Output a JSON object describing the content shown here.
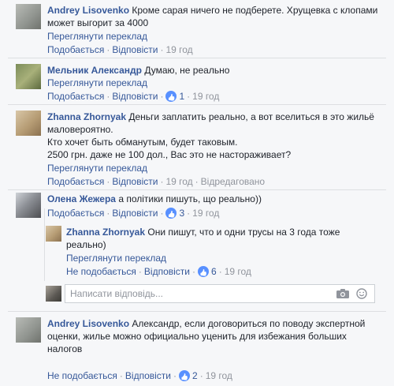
{
  "comments": [
    {
      "author": "Andrey Lisovenko",
      "text_lines": [
        "Кроме сарая ничего не подберете. Хрущевка с клопами",
        "может выгорит за 4000"
      ],
      "see_translation": "Переглянути переклад",
      "like_label": "Подобається",
      "reply_label": "Відповісти",
      "time": "19 год"
    },
    {
      "author": "Мельник Александр",
      "text_lines": [
        "Думаю, не реально"
      ],
      "see_translation": "Переглянути переклад",
      "like_label": "Подобається",
      "reply_label": "Відповісти",
      "likes": "1",
      "time": "19 год"
    },
    {
      "author": "Zhanna Zhornyak",
      "text_lines": [
        "Деньги заплатить реально, а вот вселиться в это жильё",
        "маловероятно.",
        "Кто хочет быть обманутым, будет таковым.",
        "2500 грн. даже не 100 дол., Вас это не настораживает?"
      ],
      "see_translation": "Переглянути переклад",
      "like_label": "Подобається",
      "reply_label": "Відповісти",
      "time": "19 год",
      "edited": "Відредаговано"
    },
    {
      "author": "Олена Жежера",
      "text_lines": [
        "а політики пишуть, що реально))"
      ],
      "like_label": "Подобається",
      "reply_label": "Відповісти",
      "likes": "3",
      "time": "19 год"
    },
    {
      "author": "Zhanna Zhornyak",
      "text_lines": [
        "Они пишут, что и одни трусы на 3 года тоже",
        "реально)"
      ],
      "see_translation": "Переглянути переклад",
      "like_label": "Не подобається",
      "reply_label": "Відповісти",
      "likes": "6",
      "time": "19 год"
    },
    {
      "author": "Andrey Lisovenko",
      "text_lines": [
        "Александр, если договориться по поводу экспертной",
        "оценки, жилье можно официально уценить для избежания больших",
        "налогов"
      ],
      "like_label": "Не подобається",
      "reply_label": "Відповісти",
      "likes": "2",
      "time": "19 год"
    }
  ],
  "reply_box": {
    "placeholder": "Написати відповідь..."
  },
  "colors": {
    "link": "#365899",
    "meta": "#90949c",
    "like_blue": "#5890ff"
  },
  "icons": [
    "camera-icon",
    "emoji-icon",
    "like-icon"
  ]
}
